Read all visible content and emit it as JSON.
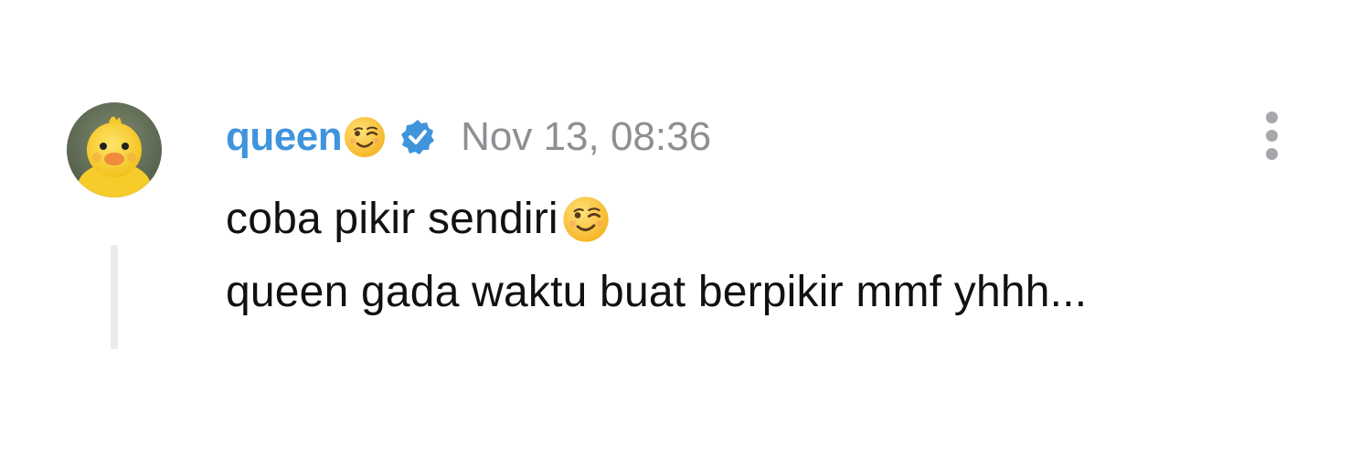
{
  "comment": {
    "username": "queen",
    "username_emoji": "winking-face-icon",
    "verified_badge": "verified-badge-icon",
    "timestamp": "Nov 13, 08:36",
    "lines": [
      {
        "text": "coba pikir sendiri",
        "emoji": "winking-face-icon"
      },
      {
        "text": "queen gada waktu buat berpikir mmf yhhh..."
      }
    ],
    "avatar": "duck-avatar-icon",
    "menu_icon": "more-vertical-icon"
  },
  "colors": {
    "username": "#3f94dc",
    "timestamp": "#8e8e93",
    "text": "#111111",
    "verified": "#3f94dc",
    "thread_line": "#e9eaee"
  }
}
